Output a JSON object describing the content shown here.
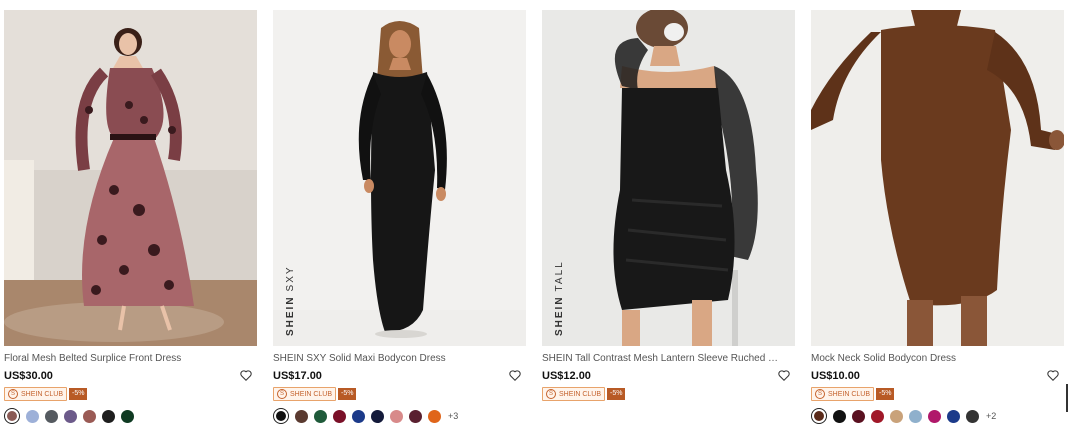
{
  "products": [
    {
      "title": "Floral Mesh Belted Surplice Front Dress",
      "price": "US$30.00",
      "brand_tag": "",
      "brand_tag_sub": "",
      "club_label": "SHEIN CLUB",
      "club_discount": "-5%",
      "image_bg": "#d9d3cc",
      "dress_color": "#9c6a6c",
      "swatches": [
        "#8a5a55",
        "#9db0d8",
        "#555a60",
        "#6c5a8a",
        "#9a5a55",
        "#1e1e1e",
        "#0f3a22"
      ],
      "more": ""
    },
    {
      "title": "SHEIN SXY Solid Maxi Bodycon Dress",
      "price": "US$17.00",
      "brand_tag": "SHEIN",
      "brand_tag_sub": "SXY",
      "club_label": "SHEIN CLUB",
      "club_discount": "-5%",
      "image_bg": "#efeeec",
      "dress_color": "#161616",
      "swatches": [
        "#111111",
        "#5a3a30",
        "#1f5a3a",
        "#7a1028",
        "#1c3a8a",
        "#141a3a",
        "#d88a8a",
        "#5a2030",
        "#e0651a"
      ],
      "more": "+3"
    },
    {
      "title": "SHEIN Tall Contrast Mesh Lantern Sleeve Ruched Bodycon Dress",
      "price": "US$12.00",
      "brand_tag": "SHEIN",
      "brand_tag_sub": "TALL",
      "club_label": "SHEIN CLUB",
      "club_discount": "-5%",
      "image_bg": "#e9e9e7",
      "dress_color": "#181818",
      "swatches": [],
      "more": ""
    },
    {
      "title": "Mock Neck Solid Bodycon Dress",
      "price": "US$10.00",
      "brand_tag": "",
      "brand_tag_sub": "",
      "club_label": "SHEIN CLUB",
      "club_discount": "-5%",
      "image_bg": "#ebe9e6",
      "dress_color": "#6a3a1e",
      "swatches": [
        "#5a2a1a",
        "#111111",
        "#5a1020",
        "#a01828",
        "#c9a27a",
        "#8fb0cc",
        "#b0186a",
        "#1c3a8a",
        "#333333"
      ],
      "more": "+2"
    }
  ],
  "icons": {
    "wishlist": "heart-outline-icon",
    "club": "shein-club-icon"
  }
}
